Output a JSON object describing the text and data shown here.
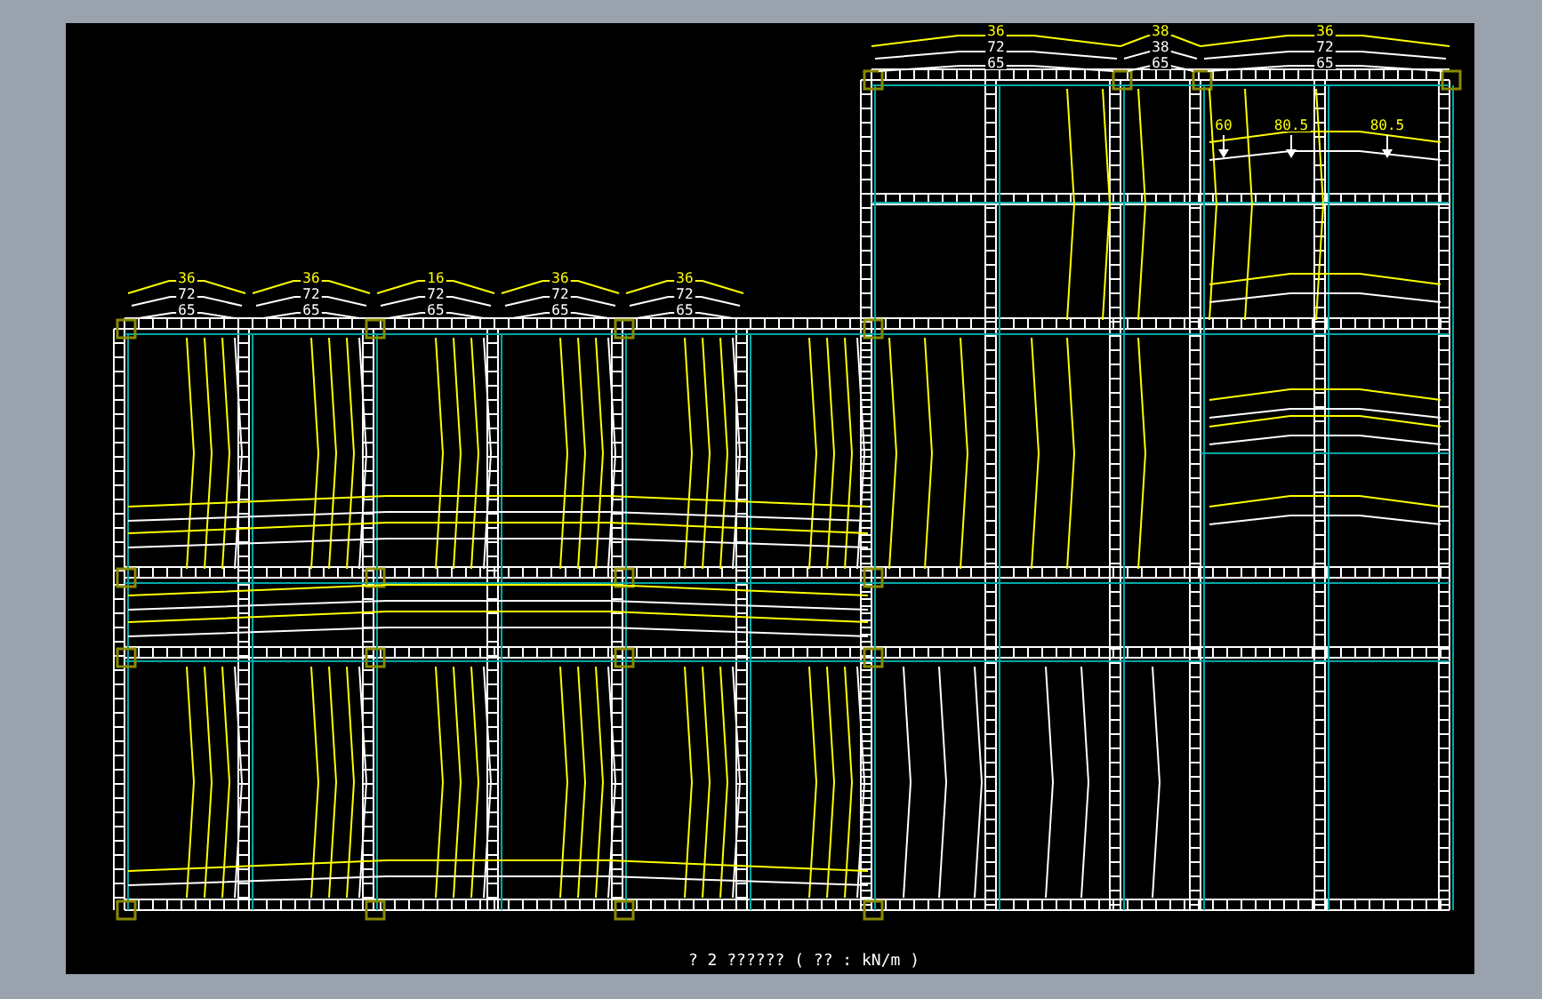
{
  "drawing": {
    "caption": "? 2 ?????? ( ?? : kN/m )",
    "upper_spans": [
      {
        "load": "36",
        "dead": "72",
        "beam": "65"
      },
      {
        "load": "36",
        "dead": "72",
        "beam": "65"
      },
      {
        "load": "16",
        "dead": "72",
        "beam": "65"
      },
      {
        "load": "36",
        "dead": "72",
        "beam": "65"
      },
      {
        "load": "36",
        "dead": "72",
        "beam": "65"
      }
    ],
    "tower_spans": [
      {
        "load": "36",
        "dead": "72",
        "beam": "65"
      },
      {
        "load": "38",
        "dead": "38",
        "beam": "65"
      },
      {
        "load": "36",
        "dead": "72",
        "beam": "65"
      }
    ],
    "point_loads": [
      "60",
      "80.5",
      "80.5"
    ]
  }
}
